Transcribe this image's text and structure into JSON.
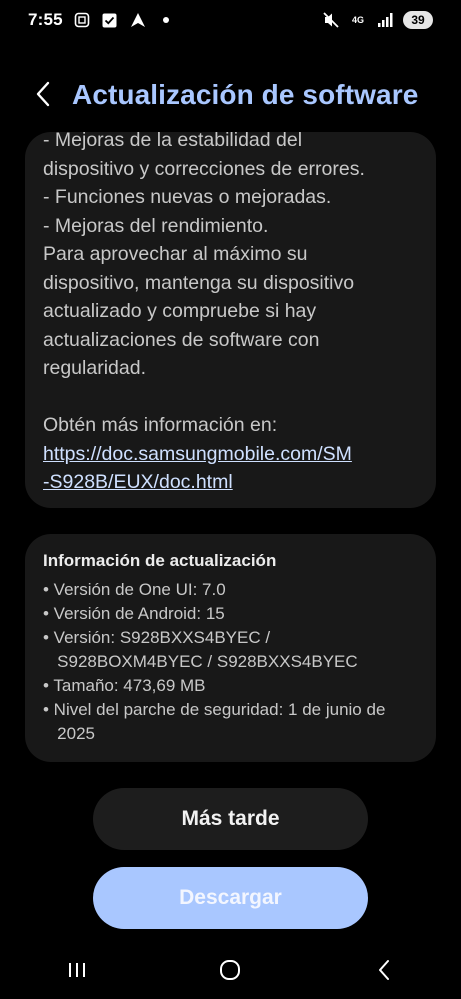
{
  "status_bar": {
    "time": "7:55",
    "left_icons": [
      "screenshot-icon",
      "checkbox-icon",
      "navigation-arrow-icon",
      "dot-icon"
    ],
    "network_label": "4G",
    "battery": "39",
    "right_icons": [
      "mute-icon",
      "network-4g-icon",
      "signal-icon",
      "battery-icon"
    ]
  },
  "header": {
    "title": "Actualización de software",
    "back_icon": "chevron-left-icon"
  },
  "notes": {
    "lines": [
      " - Mejoras de la estabilidad del",
      "dispositivo y correcciones de errores.",
      " - Funciones nuevas o mejoradas.",
      " - Mejoras del rendimiento.",
      "Para aprovechar al máximo su",
      "dispositivo, mantenga su dispositivo",
      "actualizado y compruebe si hay",
      "actualizaciones de software con",
      "regularidad."
    ],
    "more_info": "Obtén más información en:",
    "link_line1": "https://doc.samsungmobile.com/SM",
    "link_line2": "-S928B/EUX/doc.html"
  },
  "update_info": {
    "title": "Información de actualización",
    "items": [
      "• Versión de One UI: 7.0",
      "• Versión de Android: 15",
      "• Versión: S928BXXS4BYEC /",
      "   S928BOXM4BYEC / S928BXXS4BYEC",
      "• Tamaño: 473,69 MB",
      "• Nivel del parche de seguridad: 1 de junio de",
      "   2025"
    ]
  },
  "buttons": {
    "later": "Más tarde",
    "download": "Descargar"
  },
  "navbar": {
    "icons": [
      "recent-apps-icon",
      "home-icon",
      "back-icon"
    ]
  },
  "colors": {
    "background": "#000000",
    "card": "#181818",
    "accent": "#a9c7ff",
    "text_secondary": "#c8c8c8"
  }
}
